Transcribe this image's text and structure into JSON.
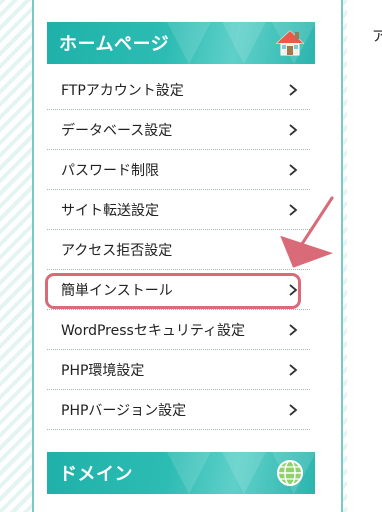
{
  "sections": {
    "homepage": {
      "label": "ホームページ",
      "icon": "house-icon"
    },
    "domain": {
      "label": "ドメイン",
      "icon": "globe-icon"
    }
  },
  "menu": {
    "items": [
      {
        "label": "FTPアカウント設定",
        "icon": "chevron-right-icon",
        "chevron": true
      },
      {
        "label": "データベース設定",
        "icon": "chevron-right-icon",
        "chevron": true
      },
      {
        "label": "パスワード制限",
        "icon": "chevron-right-icon",
        "chevron": true
      },
      {
        "label": "サイト転送設定",
        "icon": "chevron-right-icon",
        "chevron": true
      },
      {
        "label": "アクセス拒否設定",
        "icon": "chevron-right-icon",
        "chevron": false
      },
      {
        "label": "簡単インストール",
        "icon": "chevron-right-icon",
        "chevron": true,
        "highlighted": true
      },
      {
        "label": "WordPressセキュリティ設定",
        "icon": "chevron-right-icon",
        "chevron": true
      },
      {
        "label": "PHP環境設定",
        "icon": "chevron-right-icon",
        "chevron": true
      },
      {
        "label": "PHPバージョン設定",
        "icon": "chevron-right-icon",
        "chevron": true
      }
    ]
  },
  "edge_text": "ア",
  "colors": {
    "header_teal": "#2cbcb3",
    "border_teal": "#79c9c6",
    "annotation_red": "#d96a78",
    "text": "#222222"
  }
}
